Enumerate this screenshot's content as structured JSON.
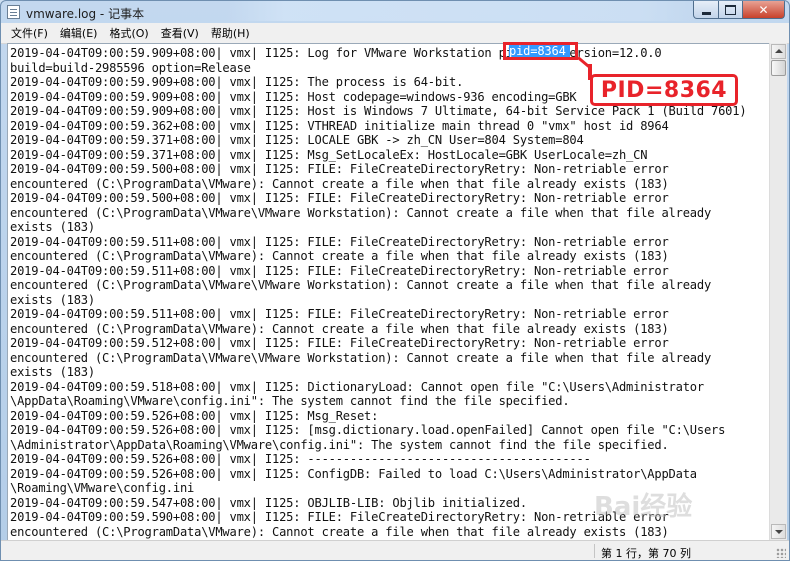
{
  "window": {
    "title": "vmware.log - 记事本"
  },
  "menu": [
    "文件(F)",
    "编辑(E)",
    "格式(O)",
    "查看(V)",
    "帮助(H)"
  ],
  "selection": {
    "text": "pid=8364"
  },
  "annotation": {
    "label": "PID=8364",
    "color": "#e8232a"
  },
  "status": {
    "position": "第 1 行，第 70 列"
  },
  "watermark": {
    "text": "Bai经验"
  },
  "log_lines": [
    "2019-04-04T09:00:59.909+08:00| vmx| I125: Log for VMware Workstation pid=8364 version=12.0.0",
    "build=build-2985596 option=Release",
    "2019-04-04T09:00:59.909+08:00| vmx| I125: The process is 64-bit.",
    "2019-04-04T09:00:59.909+08:00| vmx| I125: Host codepage=windows-936 encoding=GBK",
    "2019-04-04T09:00:59.909+08:00| vmx| I125: Host is Windows 7 Ultimate, 64-bit Service Pack 1 (Build 7601)",
    "2019-04-04T09:00:59.362+08:00| vmx| I125: VTHREAD initialize main thread 0 \"vmx\" host id 8964",
    "2019-04-04T09:00:59.371+08:00| vmx| I125: LOCALE GBK -> zh_CN User=804 System=804",
    "2019-04-04T09:00:59.371+08:00| vmx| I125: Msg_SetLocaleEx: HostLocale=GBK UserLocale=zh_CN",
    "2019-04-04T09:00:59.500+08:00| vmx| I125: FILE: FileCreateDirectoryRetry: Non-retriable error",
    "encountered (C:\\ProgramData\\VMware): Cannot create a file when that file already exists (183)",
    "2019-04-04T09:00:59.500+08:00| vmx| I125: FILE: FileCreateDirectoryRetry: Non-retriable error",
    "encountered (C:\\ProgramData\\VMware\\VMware Workstation): Cannot create a file when that file already",
    "exists (183)",
    "2019-04-04T09:00:59.511+08:00| vmx| I125: FILE: FileCreateDirectoryRetry: Non-retriable error",
    "encountered (C:\\ProgramData\\VMware): Cannot create a file when that file already exists (183)",
    "2019-04-04T09:00:59.511+08:00| vmx| I125: FILE: FileCreateDirectoryRetry: Non-retriable error",
    "encountered (C:\\ProgramData\\VMware\\VMware Workstation): Cannot create a file when that file already",
    "exists (183)",
    "2019-04-04T09:00:59.511+08:00| vmx| I125: FILE: FileCreateDirectoryRetry: Non-retriable error",
    "encountered (C:\\ProgramData\\VMware): Cannot create a file when that file already exists (183)",
    "2019-04-04T09:00:59.512+08:00| vmx| I125: FILE: FileCreateDirectoryRetry: Non-retriable error",
    "encountered (C:\\ProgramData\\VMware\\VMware Workstation): Cannot create a file when that file already",
    "exists (183)",
    "2019-04-04T09:00:59.518+08:00| vmx| I125: DictionaryLoad: Cannot open file \"C:\\Users\\Administrator",
    "\\AppData\\Roaming\\VMware\\config.ini\": The system cannot find the file specified.",
    "2019-04-04T09:00:59.526+08:00| vmx| I125: Msg_Reset:",
    "2019-04-04T09:00:59.526+08:00| vmx| I125: [msg.dictionary.load.openFailed] Cannot open file \"C:\\Users",
    "\\Administrator\\AppData\\Roaming\\VMware\\config.ini\": The system cannot find the file specified.",
    "2019-04-04T09:00:59.526+08:00| vmx| I125: ----------------------------------------",
    "2019-04-04T09:00:59.526+08:00| vmx| I125: ConfigDB: Failed to load C:\\Users\\Administrator\\AppData",
    "\\Roaming\\VMware\\config.ini",
    "2019-04-04T09:00:59.547+08:00| vmx| I125: OBJLIB-LIB: Objlib initialized.",
    "2019-04-04T09:00:59.590+08:00| vmx| I125: FILE: FileCreateDirectoryRetry: Non-retriable error",
    "encountered (C:\\ProgramData\\VMware): Cannot create a file when that file already exists (183)"
  ]
}
